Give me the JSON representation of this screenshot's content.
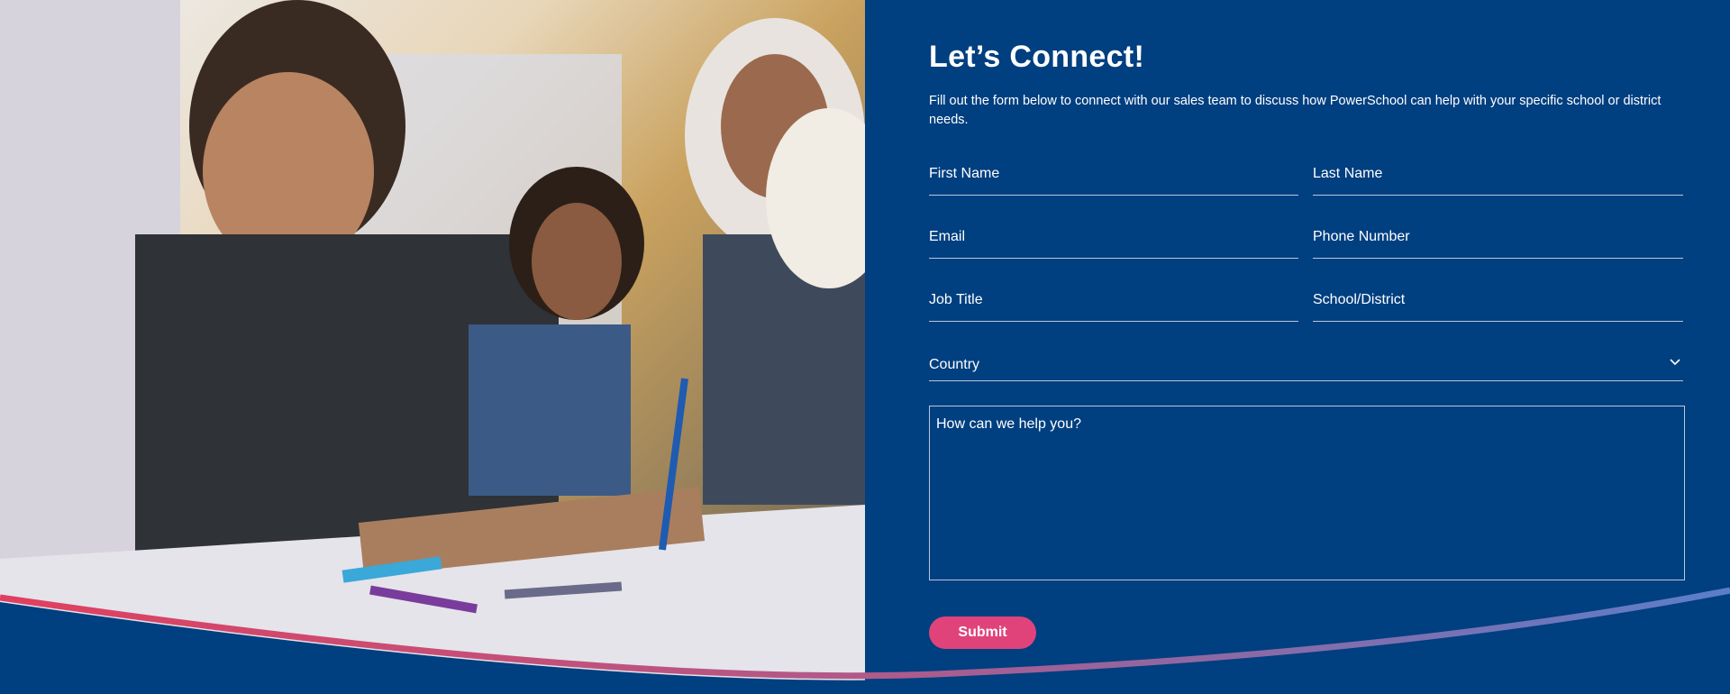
{
  "photo": {
    "description_icon": "photo-teacher-children-drawing"
  },
  "form": {
    "title": "Let’s Connect!",
    "subtitle": "Fill out the form below to connect with our sales team to discuss how PowerSchool can help with your specific school or district needs.",
    "first_name": "First Name",
    "last_name": "Last Name",
    "email": "Email",
    "phone": "Phone Number",
    "job_title": "Job Title",
    "school": "School/District",
    "country": "Country",
    "message": "How can we help you?",
    "submit": "Submit"
  },
  "colors": {
    "panel_bg": "#003f80",
    "accent_pink": "#e0437a",
    "wave_start": "#e0405f",
    "wave_end": "#5b7ec9"
  }
}
